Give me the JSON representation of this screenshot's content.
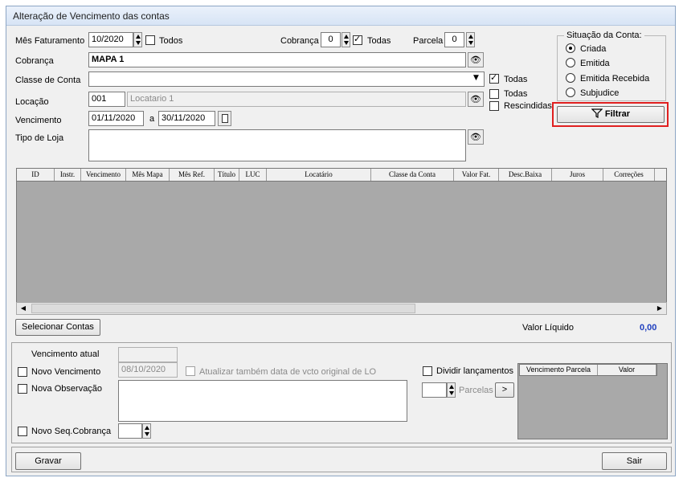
{
  "window": {
    "title": "Alteração de Vencimento das contas"
  },
  "mes_faturamento": {
    "label": "Mês Faturamento",
    "value": "10/2020",
    "todos_label": "Todos",
    "todos_checked": false
  },
  "cobranca_num": {
    "label": "Cobrança",
    "value": "0",
    "todas_label": "Todas",
    "todas_checked": true
  },
  "parcela": {
    "label": "Parcela",
    "value": "0"
  },
  "cobranca": {
    "label": "Cobrança",
    "value": "MAPA 1"
  },
  "classe_conta": {
    "label": "Classe de Conta",
    "value": "",
    "todas_label": "Todas",
    "todas_checked": true
  },
  "locacao": {
    "label": "Locação",
    "code": "001",
    "name": "Locatario 1",
    "todas_label": "Todas",
    "rescindidas_label": "Rescindidas"
  },
  "vencimento": {
    "label": "Vencimento",
    "from": "01/11/2020",
    "sep": "a",
    "to": "30/11/2020"
  },
  "tipo_loja": {
    "label": "Tipo de Loja",
    "value": ""
  },
  "situacao": {
    "title": "Situação da Conta:",
    "options": [
      {
        "label": "Criada",
        "selected": true
      },
      {
        "label": "Emitida",
        "selected": false
      },
      {
        "label": "Emitida Recebida",
        "selected": false
      },
      {
        "label": "Subjudice",
        "selected": false
      }
    ]
  },
  "filtrar_label": "Filtrar",
  "grid": {
    "columns": [
      "ID",
      "Instr.",
      "Vencimento",
      "Mês Mapa",
      "Mês Ref.",
      "Título",
      "LUC",
      "Locatário",
      "Classe da Conta",
      "Valor Fat.",
      "Desc.Baixa",
      "Juros",
      "Correções"
    ]
  },
  "selecionar_label": "Selecionar Contas",
  "valor_liquido": {
    "label": "Valor Líquido",
    "value": "0,00"
  },
  "vencimento_atual": {
    "label": "Vencimento atual",
    "value": ""
  },
  "novo_vencimento": {
    "label": "Novo Vencimento",
    "value": "08/10/2020",
    "atualizar_label": "Atualizar também data de vcto original de LO"
  },
  "nova_observacao": {
    "label": "Nova Observação",
    "value": ""
  },
  "novo_seq": {
    "label": "Novo Seq.Cobrança",
    "value": ""
  },
  "dividir": {
    "label": "Dividir lançamentos",
    "parcelas_label": "Parcelas",
    "go_label": ">",
    "columns": [
      "Vencimento Parcela",
      "Valor"
    ]
  },
  "gravar_label": "Gravar",
  "sair_label": "Sair",
  "colors": {
    "highlight_border": "#e02020",
    "accent_value": "#1f3fbf"
  }
}
